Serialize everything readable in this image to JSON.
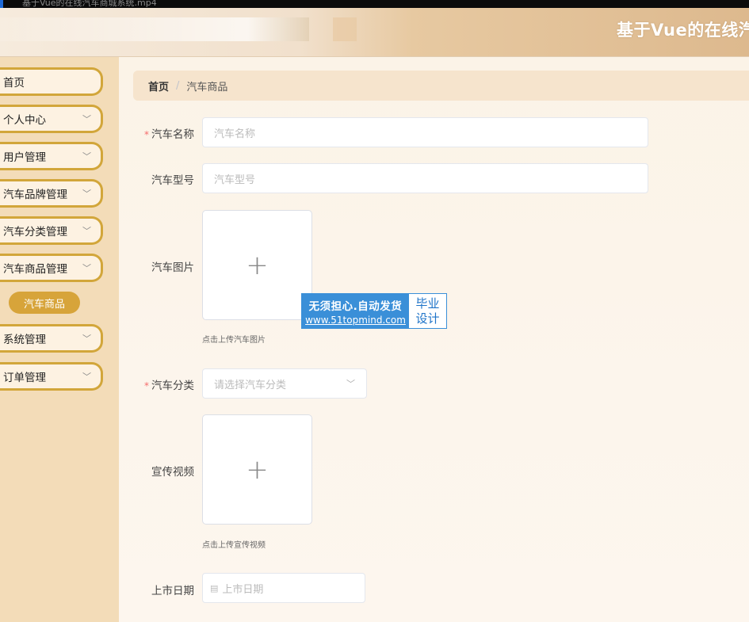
{
  "window": {
    "tab_title": "基于Vue的在线汽车商城系统.mp4"
  },
  "header": {
    "title": "基于Vue的在线汽"
  },
  "sidebar": {
    "items": [
      {
        "label": "首页",
        "has_arrow": false
      },
      {
        "label": "个人中心",
        "has_arrow": true
      },
      {
        "label": "用户管理",
        "has_arrow": true
      },
      {
        "label": "汽车品牌管理",
        "has_arrow": true
      },
      {
        "label": "汽车分类管理",
        "has_arrow": true
      },
      {
        "label": "汽车商品管理",
        "has_arrow": true
      },
      {
        "label": "系统管理",
        "has_arrow": true
      },
      {
        "label": "订单管理",
        "has_arrow": true
      }
    ],
    "active_sub_item": "汽车商品"
  },
  "breadcrumb": {
    "home": "首页",
    "separator": "/",
    "current": "汽车商品"
  },
  "form": {
    "name": {
      "label": "汽车名称",
      "placeholder": "汽车名称",
      "required": true
    },
    "model": {
      "label": "汽车型号",
      "placeholder": "汽车型号"
    },
    "image": {
      "label": "汽车图片",
      "tip": "点击上传汽车图片"
    },
    "category": {
      "label": "汽车分类",
      "placeholder": "请选择汽车分类",
      "required": true
    },
    "video": {
      "label": "宣传视频",
      "tip": "点击上传宣传视频"
    },
    "release_date": {
      "label": "上市日期",
      "placeholder": "上市日期"
    }
  },
  "watermark": {
    "line1": "无须担心.自动发货",
    "line2": "www.51topmind.com",
    "right1": "毕业",
    "right2": "设计"
  },
  "colors": {
    "accent": "#d7a43a",
    "sidebar_bg": "#f3dcb8",
    "required": "#f56c6c",
    "watermark": "#3a8fd8"
  }
}
